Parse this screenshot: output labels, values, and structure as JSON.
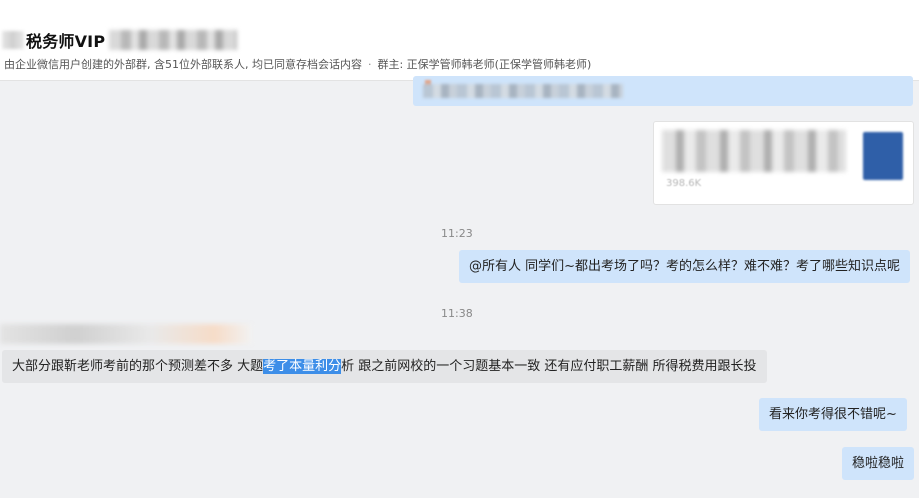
{
  "header": {
    "group_name": "税务师VIP",
    "subtitle_main": "由企业微信用户创建的外部群, 含51位外部联系人, 均已同意存档会话内容",
    "subtitle_sep": "·",
    "subtitle_owner": "群主: 正保学管师韩老师(正保学管师韩老师)"
  },
  "file_card": {
    "size_text": "398.6K"
  },
  "timestamps": [
    "11:23",
    "11:38"
  ],
  "messages": [
    {
      "side": "right",
      "text": "@所有人  同学们~都出考场了吗？考的怎么样？难不难？考了哪些知识点呢"
    },
    {
      "side": "left",
      "text_before": "大部分跟靳老师考前的那个预测差不多 大题",
      "text_highlighted": "考了本量利分",
      "text_after": "析 跟之前网校的一个习题基本一致 还有应付职工薪酬 所得税费用跟长投"
    },
    {
      "side": "right",
      "text": "看来你考得很不错呢~"
    },
    {
      "side": "right",
      "text": "稳啦稳啦"
    }
  ],
  "colors": {
    "background": "#f0f1f3",
    "outgoing_bubble": "#cfe4fb",
    "incoming_bubble": "#e4e5e7",
    "selection_highlight": "#3d8ee8",
    "file_icon": "#2f5fa8"
  }
}
